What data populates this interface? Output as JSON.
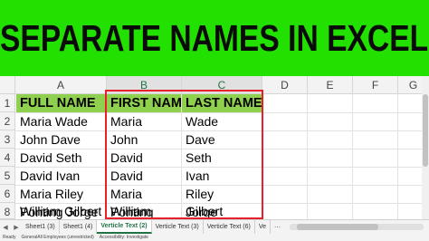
{
  "banner": {
    "title": "SEPARATE NAMES IN EXCEL"
  },
  "columns": [
    "A",
    "B",
    "C",
    "D",
    "E",
    "F",
    "G"
  ],
  "rows": [
    "1",
    "2",
    "3",
    "4",
    "5",
    "6",
    "7",
    "8"
  ],
  "table": {
    "headers": [
      "FULL NAME",
      "FIRST NAME",
      "LAST NAME"
    ],
    "data": [
      [
        "Maria Wade",
        "Maria",
        "Wade"
      ],
      [
        "John Dave",
        "John",
        "Dave"
      ],
      [
        "David Seth",
        "David",
        "Seth"
      ],
      [
        "David Ivan",
        "David",
        "Ivan"
      ],
      [
        "Maria Riley",
        "Maria",
        "Riley"
      ],
      [
        "William Gilbert",
        "William",
        "Gilbert"
      ],
      [
        "Ponting Jorge",
        "Ponting",
        "Jorge"
      ]
    ]
  },
  "sheet_tabs": {
    "tabs": [
      "Sheet1 (3)",
      "Sheet1 (4)",
      "Verticle Text (2)",
      "Verticle Text (3)",
      "Verticle Text (6)",
      "Ve"
    ],
    "active_index": 2
  },
  "status_bar": {
    "ready": "Ready",
    "label": "GeneralAll Employees (unrestricted)",
    "accessibility": "Accessibility: Investigate"
  },
  "colors": {
    "banner": "#22e000",
    "header_fill": "#8fd14f",
    "selection_border": "#e8202a",
    "active_tab": "#217346"
  }
}
